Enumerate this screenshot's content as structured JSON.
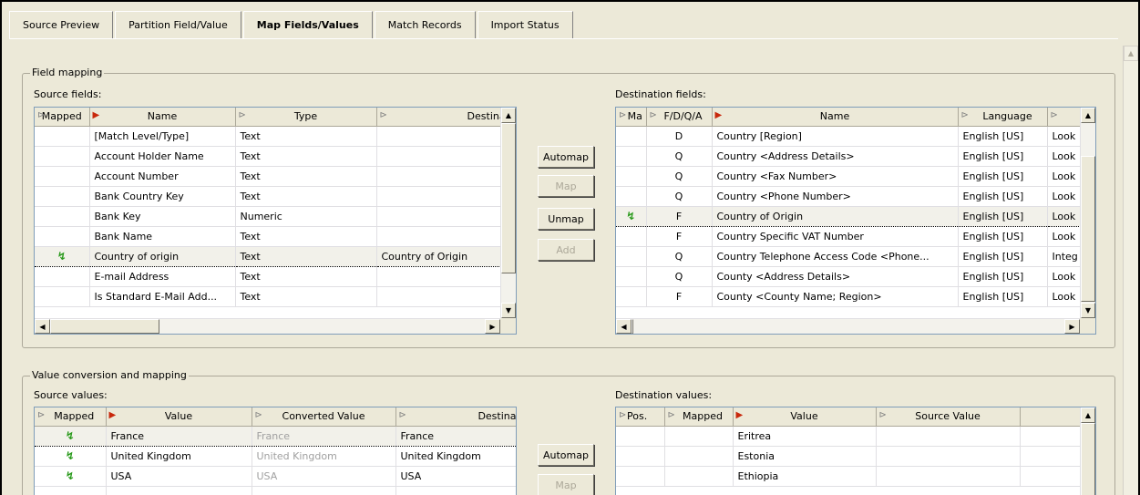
{
  "tabs": [
    "Source Preview",
    "Partition Field/Value",
    "Map Fields/Values",
    "Match Records",
    "Import Status"
  ],
  "field_mapping": {
    "title": "Field mapping",
    "source_label": "Source fields:",
    "dest_label": "Destination fields:",
    "source_columns": [
      "Mapped",
      "Name",
      "Type",
      "Destination Fie"
    ],
    "source_rows": [
      {
        "mapped": "",
        "name": "[Match Level/Type]",
        "type": "Text",
        "dest": ""
      },
      {
        "mapped": "",
        "name": "Account Holder Name",
        "type": "Text",
        "dest": ""
      },
      {
        "mapped": "",
        "name": "Account Number",
        "type": "Text",
        "dest": ""
      },
      {
        "mapped": "",
        "name": "Bank Country Key",
        "type": "Text",
        "dest": ""
      },
      {
        "mapped": "",
        "name": "Bank Key",
        "type": "Numeric",
        "dest": ""
      },
      {
        "mapped": "",
        "name": "Bank Name",
        "type": "Text",
        "dest": ""
      },
      {
        "mapped": "mapped",
        "name": "Country of origin",
        "type": "Text",
        "dest": "Country of Origin"
      },
      {
        "mapped": "",
        "name": "E-mail Address",
        "type": "Text",
        "dest": ""
      },
      {
        "mapped": "",
        "name": "Is Standard E-Mail Add...",
        "type": "Text",
        "dest": ""
      }
    ],
    "buttons": [
      "Automap",
      "Map",
      "Unmap",
      "Add"
    ],
    "dest_columns": [
      "Ma",
      "F/D/Q/A",
      "Name",
      "Language",
      ""
    ],
    "dest_rows": [
      {
        "mapped": "",
        "fdqa": "D",
        "name": "Country [Region]",
        "lang": "English [US]",
        "extra": "Look"
      },
      {
        "mapped": "",
        "fdqa": "Q",
        "name": "Country <Address Details>",
        "lang": "English [US]",
        "extra": "Look"
      },
      {
        "mapped": "",
        "fdqa": "Q",
        "name": "Country <Fax Number>",
        "lang": "English [US]",
        "extra": "Look"
      },
      {
        "mapped": "",
        "fdqa": "Q",
        "name": "Country <Phone Number>",
        "lang": "English [US]",
        "extra": "Look"
      },
      {
        "mapped": "mapped",
        "fdqa": "F",
        "name": "Country of Origin",
        "lang": "English [US]",
        "extra": "Look"
      },
      {
        "mapped": "",
        "fdqa": "F",
        "name": "Country Specific VAT Number",
        "lang": "English [US]",
        "extra": "Look"
      },
      {
        "mapped": "",
        "fdqa": "Q",
        "name": "Country Telephone Access Code <Phone...",
        "lang": "English [US]",
        "extra": "Integ"
      },
      {
        "mapped": "",
        "fdqa": "Q",
        "name": "County <Address Details>",
        "lang": "English [US]",
        "extra": "Look"
      },
      {
        "mapped": "",
        "fdqa": "F",
        "name": "County <County Name; Region>",
        "lang": "English [US]",
        "extra": "Look"
      }
    ]
  },
  "value_mapping": {
    "title": "Value conversion and mapping",
    "source_label": "Source values:",
    "dest_label": "Destination values:",
    "source_columns": [
      "Mapped",
      "Value",
      "Converted Value",
      "Destination Valu"
    ],
    "source_rows": [
      {
        "mapped": "mapped",
        "value": "France",
        "converted": "France",
        "dest": "France"
      },
      {
        "mapped": "mapped",
        "value": "United Kingdom",
        "converted": "United Kingdom",
        "dest": "United Kingdom"
      },
      {
        "mapped": "mapped",
        "value": "USA",
        "converted": "USA",
        "dest": "USA"
      }
    ],
    "buttons": [
      "Automap",
      "Map"
    ],
    "dest_columns": [
      "Pos.",
      "Mapped",
      "Value",
      "Source Value",
      ""
    ],
    "dest_rows": [
      {
        "pos": "",
        "mapped": "",
        "value": "Eritrea",
        "source": ""
      },
      {
        "pos": "",
        "mapped": "",
        "value": "Estonia",
        "source": ""
      },
      {
        "pos": "",
        "mapped": "",
        "value": "Ethiopia",
        "source": ""
      }
    ]
  },
  "icons": {
    "mapped": "green-mapped-arrows-icon",
    "sort": "sort-arrow-icon"
  },
  "colors": {
    "mapped_icon": "#2a9a1c",
    "sort_active": "#c8280c",
    "bg": "#ece9d8"
  }
}
